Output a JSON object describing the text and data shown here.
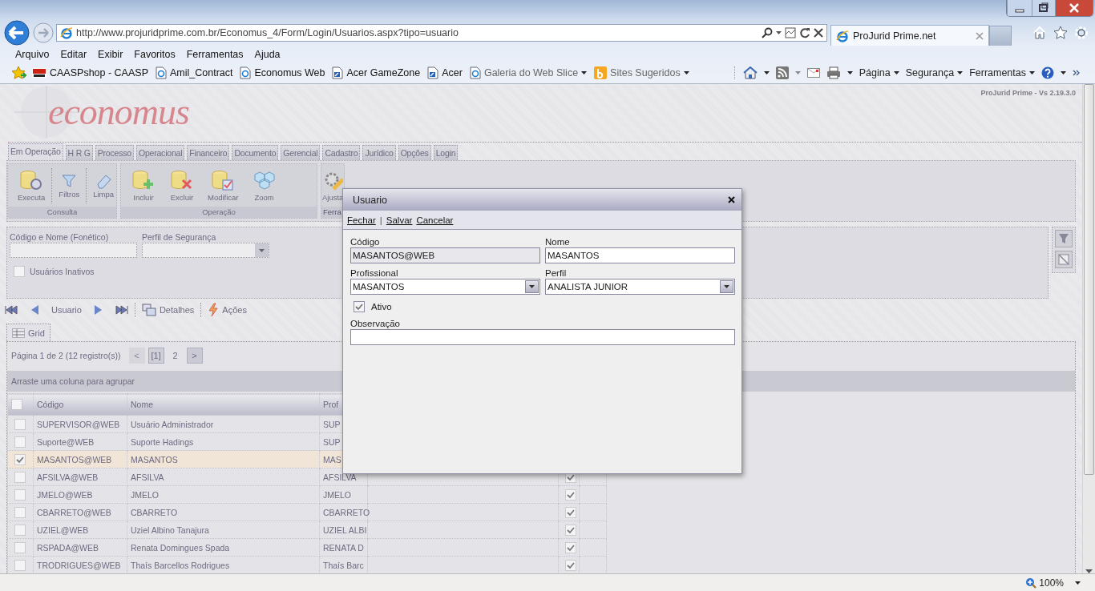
{
  "browser": {
    "address": "http://www.projuridprime.com.br/Economus_4/Form/Login/Usuarios.aspx?tipo=usuario",
    "tabs": [
      {
        "label": "ProJurid Prime.net",
        "selected": true
      }
    ],
    "menu": [
      "Arquivo",
      "Editar",
      "Exibir",
      "Favoritos",
      "Ferramentas",
      "Ajuda"
    ],
    "favorites": [
      {
        "label": "CAASPshop - CAASP",
        "kind": "badge"
      },
      {
        "label": "Amil_Contract",
        "kind": "page"
      },
      {
        "label": "Economus Web",
        "kind": "page"
      },
      {
        "label": "Acer GameZone",
        "kind": "shortcut"
      },
      {
        "label": "Acer",
        "kind": "shortcut"
      },
      {
        "label": "Galeria do Web Slice",
        "kind": "slice"
      },
      {
        "label": "Sites Sugeridos",
        "kind": "suggest"
      }
    ],
    "commands": [
      "Página",
      "Segurança",
      "Ferramentas"
    ],
    "zoom": "100%"
  },
  "app": {
    "logo": "economus",
    "version": "ProJurid Prime - Vs 2.19.3.0",
    "tabs": [
      {
        "label": "Em Operação",
        "selected": true
      },
      {
        "label": "H R G",
        "selected": false
      },
      {
        "label": "Processo",
        "selected": false
      },
      {
        "label": "Operacional",
        "selected": false
      },
      {
        "label": "Financeiro",
        "selected": false
      },
      {
        "label": "Documento",
        "selected": false
      },
      {
        "label": "Gerencial",
        "selected": false
      },
      {
        "label": "Cadastro",
        "selected": false
      },
      {
        "label": "Jurídico",
        "selected": false
      },
      {
        "label": "Opções",
        "selected": false
      },
      {
        "label": "Login",
        "selected": false
      }
    ],
    "ribbon": [
      {
        "label": "Consulta",
        "buttons": [
          {
            "label": "Executa",
            "kind": "search"
          },
          {
            "label": "Filtros",
            "kind": "funnel"
          },
          {
            "label": "Limpa",
            "kind": "eraser"
          }
        ]
      },
      {
        "label": "Operação",
        "buttons": [
          {
            "label": "Incluir",
            "kind": "add"
          },
          {
            "label": "Excluir",
            "kind": "delete"
          },
          {
            "label": "Modificar",
            "kind": "edit"
          },
          {
            "label": "Zoom",
            "kind": "zoom"
          }
        ]
      },
      {
        "label": "Ferra",
        "buttons": [
          {
            "label": "Ajusta",
            "kind": "tools"
          }
        ]
      }
    ],
    "filters": {
      "fields": [
        {
          "label": "Código e Nome (Fonético)",
          "kind": "text"
        },
        {
          "label": "Perfil de Segurança",
          "kind": "select"
        }
      ],
      "inactive": {
        "label": "Usuários Inativos",
        "checked": false
      }
    },
    "navigator": {
      "record_label": "Usuario",
      "actions": [
        {
          "label": "Detalhes",
          "kind": "details"
        },
        {
          "label": "Ações",
          "kind": "actions"
        }
      ]
    },
    "grid_tab": {
      "label": "Grid",
      "selected": true
    },
    "grid": {
      "pager": {
        "summary": "Página 1 de 2 (12 registro(s))",
        "prev": "<",
        "next": ">",
        "pages": [
          {
            "label": "[1]",
            "selected": true
          },
          {
            "label": "2",
            "selected": false
          }
        ]
      },
      "group_hint": "Arraste uma coluna para agrupar",
      "select_all": {
        "checked": false
      },
      "columns": [
        "Código",
        "Nome",
        "Prof"
      ],
      "rows": [
        {
          "code": "SUPERVISOR@WEB",
          "name": "Usuário Administrador",
          "professional": "SUP",
          "selected": false
        },
        {
          "code": "Suporte@WEB",
          "name": "Suporte Hadings",
          "professional": "SUP",
          "selected": false
        },
        {
          "code": "MASANTOS@WEB",
          "name": "MASANTOS",
          "professional": "MAS",
          "selected": true
        },
        {
          "code": "AFSILVA@WEB",
          "name": "AFSILVA",
          "professional": "AFSILVA",
          "selected": false,
          "active": true
        },
        {
          "code": "JMELO@WEB",
          "name": "JMELO",
          "professional": "JMELO",
          "selected": false,
          "active": true
        },
        {
          "code": "CBARRETO@WEB",
          "name": "CBARRETO",
          "professional": "CBARRETO",
          "selected": false,
          "active": true
        },
        {
          "code": "UZIEL@WEB",
          "name": "Uziel Albino Tanajura",
          "professional": "UZIEL ALBI",
          "selected": false,
          "active": true
        },
        {
          "code": "RSPADA@WEB",
          "name": "Renata Domingues Spada",
          "professional": "RENATA D",
          "selected": false,
          "active": true
        },
        {
          "code": "TRODRIGUES@WEB",
          "name": "Thaís Barcellos Rodrigues",
          "professional": "Thaís Barc",
          "selected": false,
          "active": true
        }
      ]
    }
  },
  "dialog": {
    "title": "Usuario",
    "actions": [
      {
        "kind": "link",
        "label": "Fechar"
      },
      {
        "kind": "separator",
        "label": "|"
      },
      {
        "kind": "link",
        "label": "Salvar"
      },
      {
        "kind": "link",
        "label": "Cancelar"
      }
    ],
    "fields": [
      {
        "label": "Código",
        "kind": "text",
        "value": "MASANTOS@WEB",
        "disabled": true
      },
      {
        "label": "Nome",
        "kind": "text",
        "value": "MASANTOS",
        "disabled": false
      },
      {
        "label": "Profissional",
        "kind": "select",
        "value": "MASANTOS",
        "disabled": false
      },
      {
        "label": "Perfil",
        "kind": "select",
        "value": "ANALISTA JUNIOR",
        "disabled": false
      }
    ],
    "active": {
      "label": "Ativo",
      "checked": true
    },
    "notes": {
      "label": "Observação"
    }
  }
}
